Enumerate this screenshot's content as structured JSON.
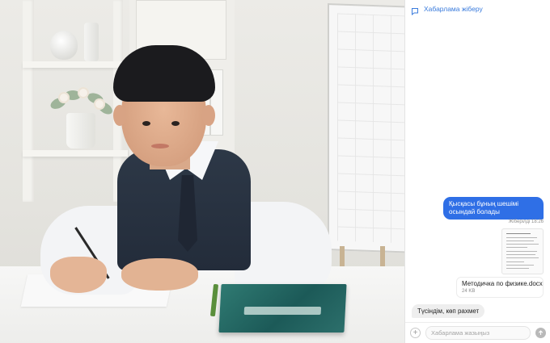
{
  "chat": {
    "header_title": "Хабарлама жіберу",
    "messages": [
      {
        "direction": "out",
        "text": "Қысқасы бұның шешімі осындай болады"
      },
      {
        "direction": "in",
        "text": "Түсіндім, көп рахмет"
      }
    ],
    "sent_status": "Жіберілді 18:26",
    "attachment": {
      "name": "Методичка по физике.docx",
      "size": "24 KB"
    },
    "composer": {
      "placeholder": "Хабарлама жазыңыз"
    },
    "accent_color": "#2f6fe6"
  },
  "icons": {
    "header": "message-square-icon",
    "composer_add": "plus-icon",
    "composer_send": "arrow-up-icon"
  }
}
